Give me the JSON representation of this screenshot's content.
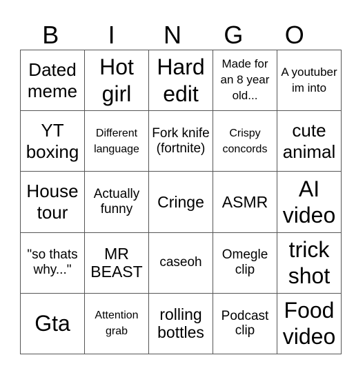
{
  "header": [
    "B",
    "I",
    "N",
    "G",
    "O"
  ],
  "rows": [
    [
      {
        "text": "Dated meme",
        "size": "s-l"
      },
      {
        "text": "Hot girl",
        "size": "s-xl"
      },
      {
        "text": "Hard edit",
        "size": "s-xl"
      },
      {
        "text": "Made for an 8 year old...",
        "size": "s-xs"
      },
      {
        "text": "A youtuber im into",
        "size": "s-xs"
      }
    ],
    [
      {
        "text": "YT boxing",
        "size": "s-l"
      },
      {
        "text": "Different language",
        "size": "s-xxs"
      },
      {
        "text": "Fork knife (fortnite)",
        "size": "s-s"
      },
      {
        "text": "Crispy concords",
        "size": "s-xxs"
      },
      {
        "text": "cute animal",
        "size": "s-l"
      }
    ],
    [
      {
        "text": "House tour",
        "size": "s-l"
      },
      {
        "text": "Actually funny",
        "size": "s-s"
      },
      {
        "text": "Cringe",
        "size": "s-m"
      },
      {
        "text": "ASMR",
        "size": "s-m"
      },
      {
        "text": "AI video",
        "size": "s-xl"
      }
    ],
    [
      {
        "text": "\"so thats why...\"",
        "size": "s-s"
      },
      {
        "text": "MR BEAST",
        "size": "s-m"
      },
      {
        "text": "caseoh",
        "size": "s-s"
      },
      {
        "text": "Omegle clip",
        "size": "s-s"
      },
      {
        "text": "trick shot",
        "size": "s-xl"
      }
    ],
    [
      {
        "text": "Gta",
        "size": "s-xl"
      },
      {
        "text": "Attention grab",
        "size": "s-xxs"
      },
      {
        "text": "rolling bottles",
        "size": "s-m"
      },
      {
        "text": "Podcast clip",
        "size": "s-s"
      },
      {
        "text": "Food video",
        "size": "s-xl"
      }
    ]
  ]
}
